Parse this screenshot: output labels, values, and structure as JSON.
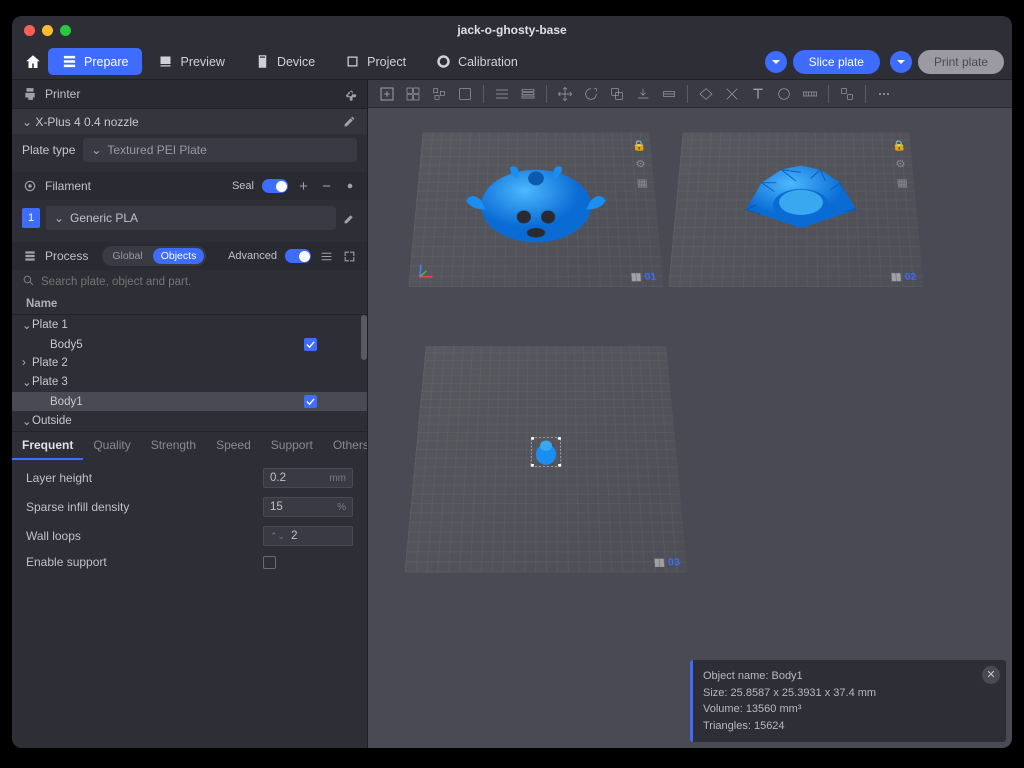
{
  "window": {
    "title": "jack-o-ghosty-base"
  },
  "nav": {
    "prepare": "Prepare",
    "preview": "Preview",
    "device": "Device",
    "project": "Project",
    "calibration": "Calibration"
  },
  "actions": {
    "slice": "Slice plate",
    "print": "Print plate"
  },
  "sidebar": {
    "printer_section": "Printer",
    "printer_model": "X-Plus 4 0.4 nozzle",
    "plate_type_label": "Plate type",
    "plate_type_value": "Textured PEI Plate",
    "filament_section": "Filament",
    "seal_label": "Seal",
    "filament_num": "1",
    "filament_name": "Generic PLA",
    "process_section": "Process",
    "scope_global": "Global",
    "scope_objects": "Objects",
    "advanced_label": "Advanced",
    "search_placeholder": "Search plate, object and part.",
    "tree_header": "Name",
    "tree": [
      {
        "label": "Plate 1",
        "expanded": true,
        "indent": 0
      },
      {
        "label": "Body5",
        "checked": true,
        "indent": 1
      },
      {
        "label": "Plate 2",
        "expanded": false,
        "indent": 0
      },
      {
        "label": "Plate 3",
        "expanded": true,
        "indent": 0
      },
      {
        "label": "Body1",
        "checked": true,
        "indent": 1,
        "selected": true
      },
      {
        "label": "Outside",
        "expanded": true,
        "indent": 0
      }
    ],
    "tabs": [
      "Frequent",
      "Quality",
      "Strength",
      "Speed",
      "Support",
      "Others"
    ],
    "active_tab": "Frequent",
    "settings": {
      "layer_height": {
        "label": "Layer height",
        "value": "0.2",
        "unit": "mm"
      },
      "infill": {
        "label": "Sparse infill density",
        "value": "15",
        "unit": "%"
      },
      "walls": {
        "label": "Wall loops",
        "value": "2"
      },
      "support": {
        "label": "Enable support",
        "checked": false
      }
    }
  },
  "viewport": {
    "plates": [
      {
        "id": "01"
      },
      {
        "id": "02"
      },
      {
        "id": "03"
      }
    ]
  },
  "info": {
    "name_label": "Object name:",
    "name": "Body1",
    "size_label": "Size:",
    "size": "25.8587 x 25.3931 x 37.4 mm",
    "volume_label": "Volume:",
    "volume": "13560 mm³",
    "tris_label": "Triangles:",
    "tris": "15624"
  },
  "colors": {
    "accent": "#3d6cff",
    "model": "#1b8ef2"
  }
}
